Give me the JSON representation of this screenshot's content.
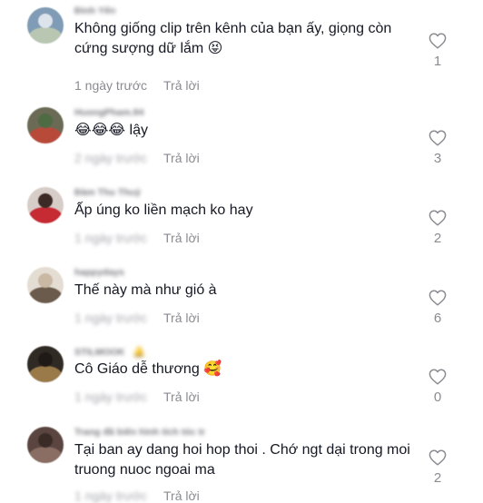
{
  "comments": [
    {
      "username": "Đinh Yến",
      "badge": "",
      "text": "Không giống clip trên kênh của bạn ấy, giọng còn cứng sượng dữ lắm 😝",
      "date": "1 ngày trước",
      "date_blurred": false,
      "reply_label": "Trả lời",
      "likes": "1",
      "avatar_colors": [
        "#7f9bb5",
        "#b9c7b2",
        "#dde3ea"
      ]
    },
    {
      "username": "HuongPham.84",
      "badge": "",
      "text": "😂😂😂 lậy",
      "date": "2 ngày trước",
      "date_blurred": true,
      "reply_label": "Trả lời",
      "likes": "3",
      "avatar_colors": [
        "#6b6a55",
        "#b84a3a",
        "#4f6b44"
      ]
    },
    {
      "username": "Đàm Thu Thuỷ",
      "badge": "",
      "text": "Ấp úng ko liền mạch ko hay",
      "date": "1 ngày trước",
      "date_blurred": true,
      "reply_label": "Trả lời",
      "likes": "2",
      "avatar_colors": [
        "#d7cdc8",
        "#c62a33",
        "#3b2a25"
      ]
    },
    {
      "username": "happydays",
      "badge": "",
      "text": "Thế này mà như gió à",
      "date": "1 ngày trước",
      "date_blurred": true,
      "reply_label": "Trả lời",
      "likes": "6",
      "avatar_colors": [
        "#e4ddd3",
        "#6b5b4c",
        "#c9b8a3"
      ]
    },
    {
      "username": "STILMOOK",
      "badge": "🔔",
      "text": "Cô Giáo dễ thương 🥰",
      "date": "1 ngày trước",
      "date_blurred": true,
      "reply_label": "Trả lời",
      "likes": "0",
      "avatar_colors": [
        "#2f2a24",
        "#9b7a4a",
        "#1f1a16"
      ]
    },
    {
      "username": "Trang đã biến hình tích tóc tr",
      "badge": "",
      "text": "Tại ban ay dang hoi hop thoi . Chớ ngt dại trong moi truong nuoc ngoai ma",
      "date": "1 ngày trước",
      "date_blurred": true,
      "reply_label": "Trả lời",
      "likes": "2",
      "avatar_colors": [
        "#5a4540",
        "#8a6d63",
        "#3a2b27"
      ]
    }
  ]
}
